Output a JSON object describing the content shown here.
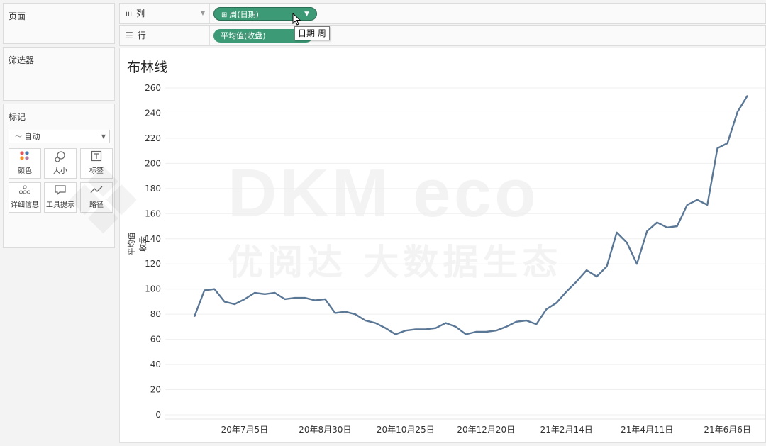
{
  "panes": {
    "pages_title": "页面",
    "filters_title": "筛选器",
    "marks_title": "标记",
    "mark_type": "自动",
    "mark_buttons": [
      {
        "label": "颜色",
        "icon": "color-dots-icon"
      },
      {
        "label": "大小",
        "icon": "size-icon"
      },
      {
        "label": "标签",
        "icon": "label-icon"
      },
      {
        "label": "详细信息",
        "icon": "detail-icon"
      },
      {
        "label": "工具提示",
        "icon": "tooltip-icon"
      },
      {
        "label": "路径",
        "icon": "path-icon"
      }
    ]
  },
  "shelves": {
    "columns_label": "列",
    "rows_label": "行",
    "columns_pill": "周(日期)",
    "rows_pill": "平均值(收盘)"
  },
  "tooltip": "日期 周",
  "watermark": {
    "brand": "DKM eco",
    "tagline": "优阅达 大数据生态"
  },
  "accent_color": "#3d9a77",
  "line_color": "#5a7796",
  "chart_data": {
    "type": "line",
    "title": "布林线",
    "ylabel": "平均值 收盘",
    "ylim": [
      0,
      260
    ],
    "yticks": [
      0,
      20,
      40,
      60,
      80,
      100,
      120,
      140,
      160,
      180,
      200,
      220,
      240,
      260
    ],
    "x_tick_labels": [
      "20年7月5日",
      "20年8月30日",
      "20年10月25日",
      "20年12月20日",
      "21年2月14日",
      "21年4月11日",
      "21年6月6日"
    ],
    "x_tick_index": [
      5,
      13,
      21,
      29,
      37,
      45,
      53
    ],
    "grid": true,
    "series": [
      {
        "values": [
          78,
          99,
          100,
          90,
          88,
          92,
          97,
          96,
          97,
          92,
          93,
          93,
          91,
          92,
          81,
          82,
          80,
          75,
          73,
          69,
          64,
          67,
          68,
          68,
          69,
          73,
          70,
          64,
          66,
          66,
          67,
          70,
          74,
          75,
          72,
          84,
          89,
          98,
          106,
          115,
          110,
          118,
          145,
          137,
          120,
          146,
          153,
          149,
          150,
          167,
          171,
          167,
          212,
          216,
          241,
          254
        ]
      }
    ]
  }
}
